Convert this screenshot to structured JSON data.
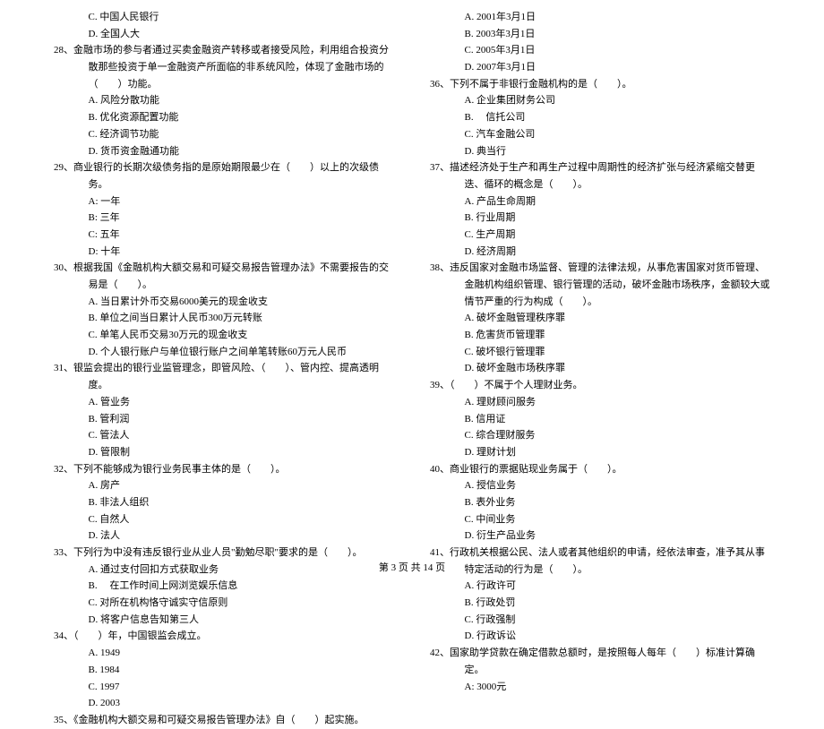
{
  "left": {
    "orphan_opts": [
      "C. 中国人民银行",
      "D. 全国人大"
    ],
    "q28": {
      "stem": "28、金融市场的参与者通过买卖金融资产转移或者接受风险，利用组合投资分散那些投资于单一金融资产所面临的非系统风险，体现了金融市场的（　　）功能。",
      "opts": [
        "A. 风险分散功能",
        "B. 优化资源配置功能",
        "C. 经济调节功能",
        "D. 货币资金融通功能"
      ]
    },
    "q29": {
      "stem": "29、商业银行的长期次级债务指的是原始期限最少在（　　）以上的次级债务。",
      "opts": [
        "A: 一年",
        "B: 三年",
        "C: 五年",
        "D: 十年"
      ]
    },
    "q30": {
      "stem": "30、根据我国《金融机构大额交易和可疑交易报告管理办法》不需要报告的交易是（　　）。",
      "opts": [
        "A. 当日累计外币交易6000美元的现金收支",
        "B. 单位之间当日累计人民币300万元转账",
        "C. 单笔人民币交易30万元的现金收支",
        "D. 个人银行账户与单位银行账户之间单笔转账60万元人民币"
      ]
    },
    "q31": {
      "stem": "31、银监会提出的银行业监管理念，即管风险、（　　）、管内控、提高透明度。",
      "opts": [
        "A. 管业务",
        "B. 管利润",
        "C. 管法人",
        "D. 管限制"
      ]
    },
    "q32": {
      "stem": "32、下列不能够成为银行业务民事主体的是（　　）。",
      "opts": [
        "A. 房产",
        "B. 非法人组织",
        "C. 自然人",
        "D. 法人"
      ]
    },
    "q33": {
      "stem": "33、下列行为中没有违反银行业从业人员\"勤勉尽职\"要求的是（　　）。",
      "opts": [
        "A. 通过支付回扣方式获取业务",
        "B. 　在工作时间上网浏览娱乐信息",
        "C. 对所在机构恪守诚实守信原则",
        "D. 将客户信息告知第三人"
      ]
    },
    "q34": {
      "stem": "34、（　　）年，中国银监会成立。",
      "opts": [
        "A. 1949",
        "B. 1984",
        "C. 1997",
        "D. 2003"
      ]
    },
    "q35": {
      "stem": "35、《金融机构大额交易和可疑交易报告管理办法》自（　　）起实施。"
    }
  },
  "right": {
    "orphan_opts": [
      "A. 2001年3月1日",
      "B. 2003年3月1日",
      "C. 2005年3月1日",
      "D. 2007年3月1日"
    ],
    "q36": {
      "stem": "36、下列不属于非银行金融机构的是（　　）。",
      "opts": [
        "A. 企业集团财务公司",
        "B. 　信托公司",
        "C. 汽车金融公司",
        "D. 典当行"
      ]
    },
    "q37": {
      "stem": "37、描述经济处于生产和再生产过程中周期性的经济扩张与经济紧缩交替更迭、循环的概念是（　　）。",
      "opts": [
        "A. 产品生命周期",
        "B. 行业周期",
        "C. 生产周期",
        "D. 经济周期"
      ]
    },
    "q38": {
      "stem": "38、违反国家对金融市场监督、管理的法律法规，从事危害国家对货币管理、金融机构组织管理、银行管理的活动，破坏金融市场秩序，金额较大或情节严重的行为构成（　　）。",
      "opts": [
        "A. 破坏金融管理秩序罪",
        "B. 危害货币管理罪",
        "C. 破坏银行管理罪",
        "D. 破坏金融市场秩序罪"
      ]
    },
    "q39": {
      "stem": "39、（　　）不属于个人理财业务。",
      "opts": [
        "A. 理财顾问服务",
        "B. 信用证",
        "C. 综合理财服务",
        "D. 理财计划"
      ]
    },
    "q40": {
      "stem": "40、商业银行的票据贴现业务属于（　　）。",
      "opts": [
        "A. 授信业务",
        "B. 表外业务",
        "C. 中间业务",
        "D. 衍生产品业务"
      ]
    },
    "q41": {
      "stem": "41、行政机关根据公民、法人或者其他组织的申请，经依法审查，准予其从事特定活动的行为是（　　）。",
      "opts": [
        "A. 行政许可",
        "B. 行政处罚",
        "C. 行政强制",
        "D. 行政诉讼"
      ]
    },
    "q42": {
      "stem": "42、国家助学贷款在确定借款总额时，是按照每人每年（　　）标准计算确定。",
      "opts": [
        "A: 3000元"
      ]
    }
  },
  "footer": "第 3 页 共 14 页"
}
